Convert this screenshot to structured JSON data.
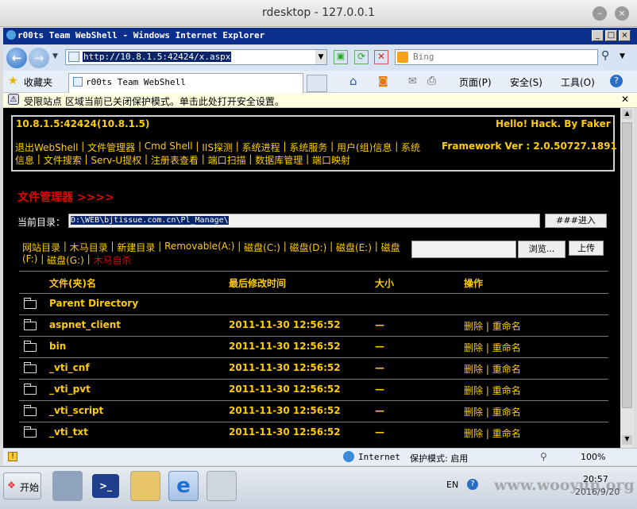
{
  "rdesktop": {
    "title": "rdesktop - 127.0.0.1"
  },
  "ie": {
    "title": "r00ts Team WebShell - Windows Internet Explorer",
    "address": "http://10.8.1.5:42424/x.aspx",
    "search_placeholder": "Bing",
    "favorites_label": "收藏夹",
    "tab_title": "r00ts Team WebShell",
    "menu": {
      "page": "页面(P)",
      "safety": "安全(S)",
      "tools": "工具(O)"
    },
    "info_bar": "受限站点 区域当前已关闭保护模式。单击此处打开安全设置。",
    "status": {
      "zone": "Internet",
      "protected_mode": "保护模式: 启用",
      "zoom": "100%"
    }
  },
  "shell": {
    "host": "10.8.1.5:42424(10.8.1.5)",
    "greeting": "Hello! Hack. By Faker",
    "framework": "Framework Ver : 2.0.50727.1891",
    "nav_line1": [
      "退出WebShell",
      "文件管理器",
      "Cmd Shell",
      "IIS探测",
      "系统进程",
      "系统服务",
      "用户(组)信息",
      "系统"
    ],
    "nav_line2": [
      "信息",
      "文件搜索",
      "Serv-U提权",
      "注册表查看",
      "端口扫描",
      "数据库管理",
      "端口映射"
    ],
    "fm_title": "文件管理器 >>>>",
    "current_dir_label": "当前目录：",
    "current_dir": "D:\\WEB\\bjtissue.com.cn\\Pl_Manage\\",
    "enter_button": "###进入###",
    "drive_line1": [
      "网站目录",
      "木马目录",
      "新建目录",
      "Removable(A:)",
      "磁盘(C:)",
      "磁盘(D:)",
      "磁盘(E:)",
      "磁盘"
    ],
    "drive_line2_a": "(F:)",
    "drive_line2_b": "磁盘(G:)",
    "drive_line2_c": "木马自杀",
    "browse_button": "浏览...",
    "upload_button": "上传",
    "columns": {
      "name": "文件(夹)名",
      "modified": "最后修改时间",
      "size": "大小",
      "ops": "操作"
    },
    "parent_dir": "Parent Directory",
    "op_delete": "删除",
    "op_rename": "重命名",
    "rows": [
      {
        "name": "aspnet_client",
        "modified": "2011-11-30 12:56:52",
        "size": "—"
      },
      {
        "name": "bin",
        "modified": "2011-11-30 12:56:52",
        "size": "—"
      },
      {
        "name": "_vti_cnf",
        "modified": "2011-11-30 12:56:52",
        "size": "—"
      },
      {
        "name": "_vti_pvt",
        "modified": "2011-11-30 12:56:52",
        "size": "—"
      },
      {
        "name": "_vti_script",
        "modified": "2011-11-30 12:56:52",
        "size": "—"
      },
      {
        "name": "_vti_txt",
        "modified": "2011-11-30 12:56:52",
        "size": "—"
      }
    ]
  },
  "taskbar": {
    "start": "开始",
    "lang": "EN",
    "time": "20:57",
    "date": "2016/9/20",
    "watermark": "www.wooyun.org"
  }
}
